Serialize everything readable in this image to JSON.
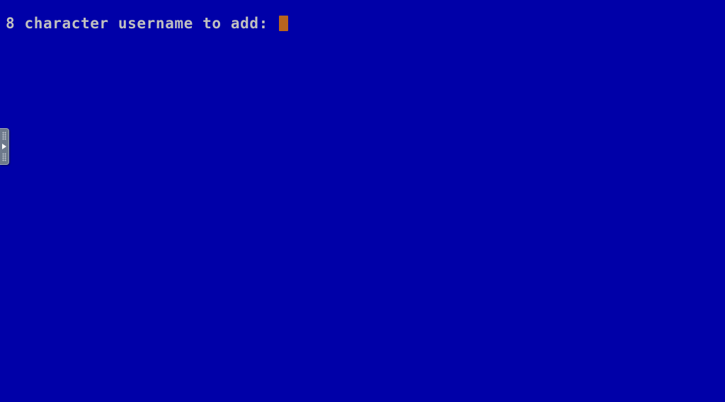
{
  "console": {
    "prompt": "8 character username to add: ",
    "input_value": ""
  },
  "side_panel": {
    "icon": "expand-arrow-icon"
  },
  "colors": {
    "background": "#0000a8",
    "text": "#c0c0c0",
    "cursor": "#b8641e",
    "handle": "#6e7a8c"
  }
}
